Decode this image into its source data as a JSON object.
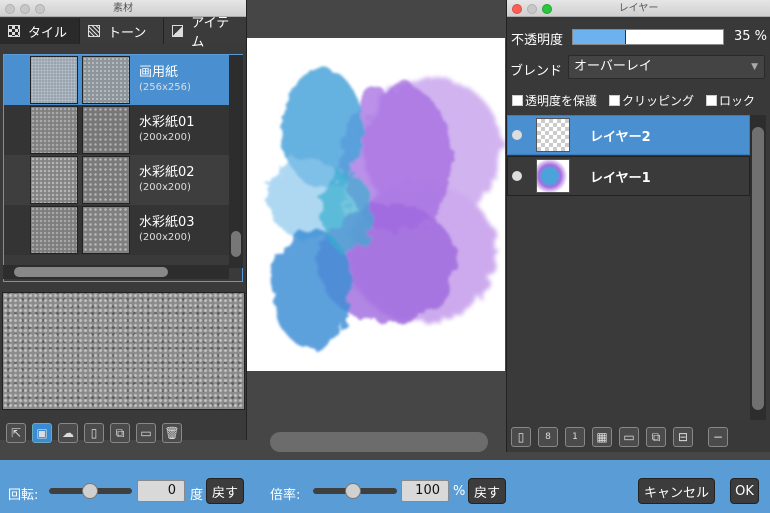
{
  "material_panel": {
    "title": "素材",
    "tabs": [
      {
        "label": "タイル",
        "icon": "tile-icon"
      },
      {
        "label": "トーン",
        "icon": "tone-icon"
      },
      {
        "label": "アイテム",
        "icon": "item-icon"
      }
    ],
    "items": [
      {
        "name": "画用紙",
        "size": "(256x256)",
        "selected": true
      },
      {
        "name": "水彩紙01",
        "size": "(200x200)",
        "selected": false
      },
      {
        "name": "水彩紙02",
        "size": "(200x200)",
        "selected": false
      },
      {
        "name": "水彩紙03",
        "size": "(200x200)",
        "selected": false
      }
    ],
    "tools": [
      "import-icon",
      "tile-apply-icon",
      "cloud-upload-icon",
      "new-file-icon",
      "duplicate-icon",
      "folder-icon",
      "trash-icon"
    ]
  },
  "layer_panel": {
    "title": "レイヤー",
    "opacity_label": "不透明度",
    "opacity_value": "35 %",
    "opacity_fraction": 0.35,
    "blend_label": "ブレンド",
    "blend_value": "オーバーレイ",
    "checkboxes": [
      "透明度を保護",
      "クリッピング",
      "ロック"
    ],
    "layers": [
      {
        "name": "レイヤー2",
        "selected": true
      },
      {
        "name": "レイヤー1",
        "selected": false
      }
    ],
    "tools": [
      "new-layer-icon",
      "new-8bit-layer-icon",
      "new-1bit-layer-icon",
      "tone-layer-icon",
      "layer-folder-icon",
      "duplicate-layer-icon",
      "merge-layer-icon",
      "delete-layer-icon"
    ]
  },
  "bottom_bar": {
    "rotation_label": "回転:",
    "rotation_value": "0",
    "rotation_unit": "度",
    "reset_label": "戻す",
    "scale_label": "倍率:",
    "scale_value": "100",
    "scale_unit": "%",
    "reset2_label": "戻す",
    "cancel_label": "キャンセル",
    "ok_label": "OK"
  },
  "colors": {
    "accent": "#4a8fcf",
    "bottom_bar": "#5a9dd6",
    "paint_blue": "#4aa3db",
    "paint_purple": "#a86ee0"
  }
}
